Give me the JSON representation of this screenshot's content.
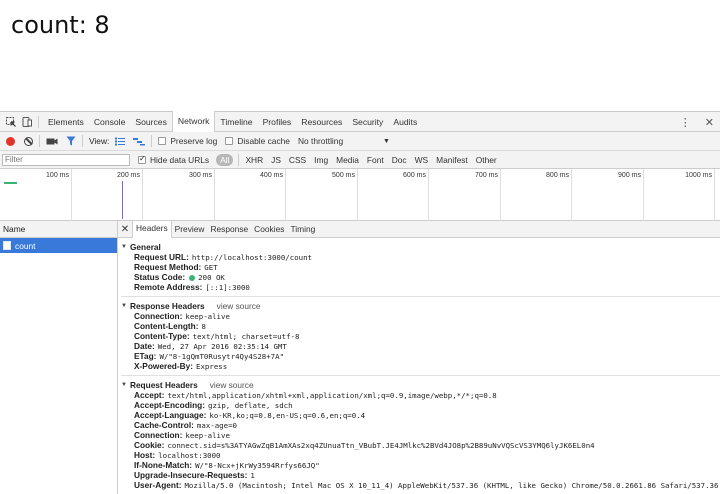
{
  "page": {
    "heading": "count: 8"
  },
  "devtools": {
    "tabs": [
      "Elements",
      "Console",
      "Sources",
      "Network",
      "Timeline",
      "Profiles",
      "Resources",
      "Security",
      "Audits"
    ],
    "active_tab": "Network",
    "toolbar": {
      "view_label": "View:",
      "preserve_log": "Preserve log",
      "disable_cache": "Disable cache",
      "throttling": "No throttling"
    },
    "filter": {
      "placeholder": "Filter",
      "hide_data_urls": "Hide data URLs",
      "types": [
        "All",
        "XHR",
        "JS",
        "CSS",
        "Img",
        "Media",
        "Font",
        "Doc",
        "WS",
        "Manifest",
        "Other"
      ]
    },
    "timeline": {
      "ticks": [
        "100 ms",
        "200 ms",
        "300 ms",
        "400 ms",
        "500 ms",
        "600 ms",
        "700 ms",
        "800 ms",
        "900 ms",
        "1000 ms"
      ]
    },
    "list": {
      "header": "Name",
      "items": [
        "count"
      ]
    },
    "detail_tabs": [
      "Headers",
      "Preview",
      "Response",
      "Cookies",
      "Timing"
    ],
    "general": {
      "title": "General",
      "rows": [
        {
          "k": "Request URL:",
          "v": "http://localhost:3000/count"
        },
        {
          "k": "Request Method:",
          "v": "GET"
        },
        {
          "k": "Status Code:",
          "v": "200 OK"
        },
        {
          "k": "Remote Address:",
          "v": "[::1]:3000"
        }
      ]
    },
    "response_headers": {
      "title": "Response Headers",
      "view_source": "view source",
      "rows": [
        {
          "k": "Connection:",
          "v": "keep-alive"
        },
        {
          "k": "Content-Length:",
          "v": "8"
        },
        {
          "k": "Content-Type:",
          "v": "text/html; charset=utf-8"
        },
        {
          "k": "Date:",
          "v": "Wed, 27 Apr 2016 02:35:14 GMT"
        },
        {
          "k": "ETag:",
          "v": "W/\"8-1gQmT0Rusytr4Qy4S28+7A\""
        },
        {
          "k": "X-Powered-By:",
          "v": "Express"
        }
      ]
    },
    "request_headers": {
      "title": "Request Headers",
      "view_source": "view source",
      "rows": [
        {
          "k": "Accept:",
          "v": "text/html,application/xhtml+xml,application/xml;q=0.9,image/webp,*/*;q=0.8"
        },
        {
          "k": "Accept-Encoding:",
          "v": "gzip, deflate, sdch"
        },
        {
          "k": "Accept-Language:",
          "v": "ko-KR,ko;q=0.8,en-US;q=0.6,en;q=0.4"
        },
        {
          "k": "Cache-Control:",
          "v": "max-age=0"
        },
        {
          "k": "Connection:",
          "v": "keep-alive"
        },
        {
          "k": "Cookie:",
          "v": "connect.sid=s%3ATYAGwZqB1AmXAs2xq4ZUnuaTtn_VBubT.JE4JMlkc%2BVd4JO8p%2B89uNvVQScVS3YMQ6lyJK6EL0n4"
        },
        {
          "k": "Host:",
          "v": "localhost:3000"
        },
        {
          "k": "If-None-Match:",
          "v": "W/\"8-Ncx+jKrWy3594Rrfys66JQ\""
        },
        {
          "k": "Upgrade-Insecure-Requests:",
          "v": "1"
        },
        {
          "k": "User-Agent:",
          "v": "Mozilla/5.0 (Macintosh; Intel Mac OS X 10_11_4) AppleWebKit/537.36 (KHTML, like Gecko) Chrome/50.0.2661.86 Safari/537.36"
        }
      ]
    }
  }
}
